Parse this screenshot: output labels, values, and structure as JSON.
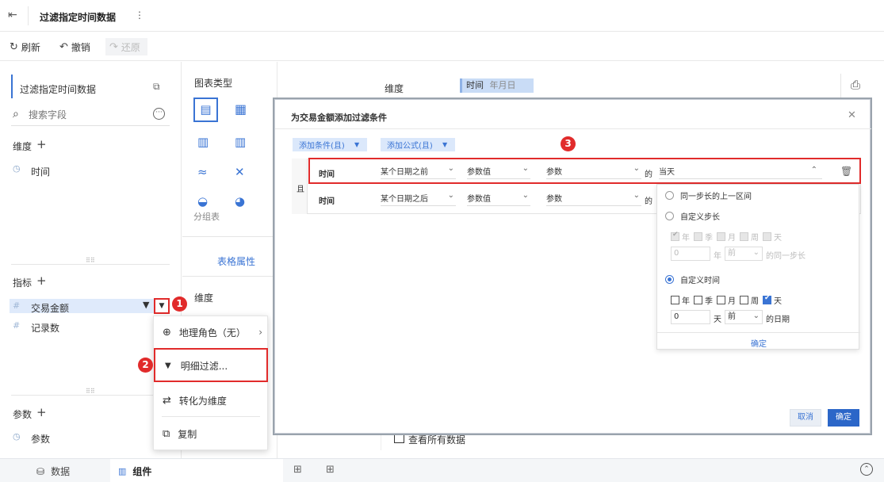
{
  "title_bar": {
    "title": "过滤指定时间数据"
  },
  "toolbar": {
    "refresh": "刷新",
    "undo": "撤销",
    "redo": "还原"
  },
  "left": {
    "dataset": "过滤指定时间数据",
    "search_placeholder": "搜索字段",
    "dimension_header": "维度",
    "dimension_items": [
      "时间"
    ],
    "measure_header": "指标",
    "measure_items": [
      "交易金额",
      "记录数"
    ],
    "param_header": "参数",
    "param_items": [
      "参数"
    ]
  },
  "middle": {
    "chart_type_label": "图表类型",
    "group_table_label": "分组表",
    "table_props_tab": "表格属性",
    "dimension_label": "维度"
  },
  "right": {
    "dimension_label": "维度",
    "dimension_chip": "时间",
    "dimension_chip_sub": "年月日",
    "view_all_label": "查看所有数据"
  },
  "context_menu": {
    "geo_role": "地理角色（无）",
    "detail_filter": "明细过滤...",
    "convert_dimension": "转化为维度",
    "copy": "复制"
  },
  "dialog": {
    "title": "为交易金额添加过滤条件",
    "add_condition": "添加条件(且)",
    "add_formula": "添加公式(且)",
    "and_label": "且",
    "rows": [
      {
        "field": "时间",
        "op": "某个日期之前",
        "value_type": "参数值",
        "param": "参数",
        "of": "的",
        "result": "当天"
      },
      {
        "field": "时间",
        "op": "某个日期之后",
        "value_type": "参数值",
        "param": "参数",
        "of": "的",
        "result": ""
      }
    ],
    "dropdown": {
      "opt_prev_period": "同一步长的上一区间",
      "opt_custom_step": "自定义步长",
      "step_units": [
        "年",
        "季",
        "月",
        "周",
        "天"
      ],
      "step_value": "0",
      "step_unit_label": "年",
      "step_dir": "前",
      "step_suffix": "的同一步长",
      "opt_custom_time": "自定义时间",
      "time_units": [
        "年",
        "季",
        "月",
        "周",
        "天"
      ],
      "time_value": "0",
      "time_unit_label": "天",
      "time_dir": "前",
      "time_suffix": "的日期",
      "confirm": "确定"
    },
    "cancel": "取消",
    "ok": "确定"
  },
  "badges": [
    "1",
    "2",
    "3"
  ],
  "bottom": {
    "data_tab": "数据",
    "component_tab": "组件"
  },
  "colors": {
    "accent": "#3a74d4",
    "annotation_red": "#e12b2b",
    "chip_bg": "#c9dcf6"
  }
}
